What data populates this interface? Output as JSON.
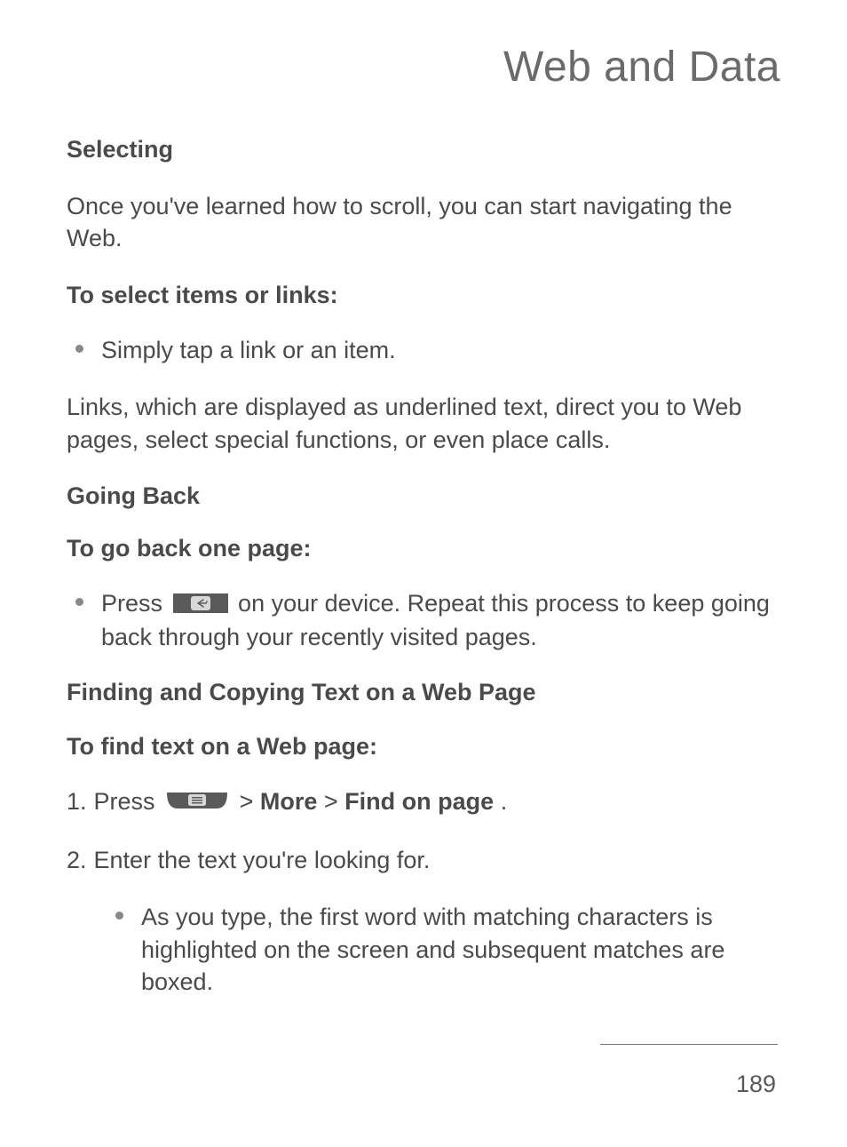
{
  "page_title": "Web and Data",
  "section1": {
    "heading": "Selecting",
    "intro": "Once you've learned how to scroll, you can start navigating the Web.",
    "sub1": "To select items or links:",
    "bullet1": "Simply tap a link or an item.",
    "para1": "Links, which are displayed as underlined text, direct you to Web pages, select special functions, or even place calls."
  },
  "section2": {
    "heading": "Going Back",
    "sub1": "To go back one page:",
    "bullet1_pre": "Press ",
    "bullet1_post": " on your device. Repeat this process to keep going back through your recently visited pages."
  },
  "section3": {
    "heading": "Finding and Copying Text on a Web Page",
    "sub1": "To find text on a Web page:",
    "step1_num": "1.",
    "step1_pre": "Press ",
    "step1_sep1": " > ",
    "step1_more": "More",
    "step1_sep2": " > ",
    "step1_find": "Find on page",
    "step1_period": ".",
    "step2_num": "2.",
    "step2_text": "Enter the text you're looking for.",
    "step2_bullet": "As you type, the first word with matching characters is highlighted on the screen and subsequent matches are boxed."
  },
  "page_number": "189"
}
